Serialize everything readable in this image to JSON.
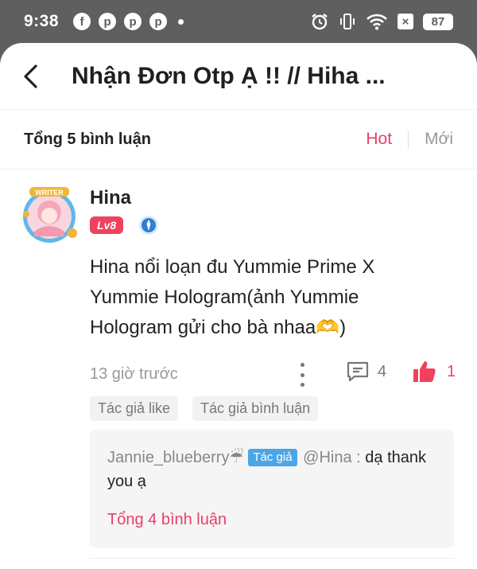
{
  "status_bar": {
    "time": "9:38",
    "app_icons": [
      "facebook-icon",
      "pinterest-icon",
      "pinterest-icon",
      "pinterest-icon"
    ],
    "battery": "87"
  },
  "header": {
    "title": "Nhận Đơn Otp Ạ !! // Hiha ..."
  },
  "comments_header": {
    "count_label": "Tổng 5 bình luận",
    "sort_hot": "Hot",
    "sort_new": "Mới"
  },
  "comment": {
    "username": "Hina",
    "level": "Lv8",
    "text": "Hina nổi loạn đu Yummie Prime X Yummie Hologram(ảnh Yummie Hologram gửi cho bà nhaa🫶)",
    "time": "13 giờ trước",
    "reply_count": "4",
    "like_count": "1",
    "tags": [
      "Tác giả like",
      "Tác giả bình luận"
    ],
    "reply": {
      "user": "Jannie_blueberry☔",
      "author_tag": "Tác giả",
      "mention": "@Hina :",
      "text": " dạ thank you ạ"
    },
    "total_replies": "Tổng 4 bình luận"
  },
  "colors": {
    "accent": "#e8406a",
    "level_badge": "#f0415d",
    "author_tag": "#4aa6e6"
  }
}
